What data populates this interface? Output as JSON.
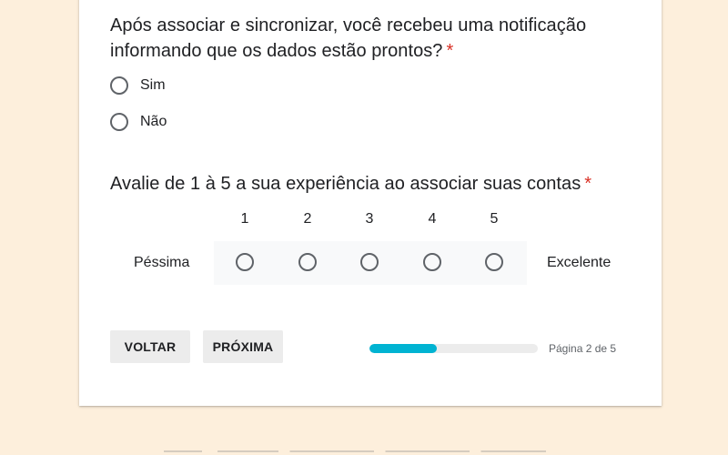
{
  "colors": {
    "page_background": "#fdefdc",
    "card_background": "#ffffff",
    "required_star": "#d93025",
    "progress_fill": "#00b3d2",
    "progress_track": "#ececec",
    "button_background": "#ececec"
  },
  "question1": {
    "title": "Após associar e sincronizar, você recebeu uma notificação informando que os dados estão prontos?",
    "required_mark": "*",
    "options": [
      {
        "label": "Sim",
        "selected": false,
        "icon": "radio-unchecked-icon"
      },
      {
        "label": "Não",
        "selected": false,
        "icon": "radio-unchecked-icon"
      }
    ]
  },
  "question2": {
    "title": "Avalie de 1 à 5 a sua experiência ao associar suas contas",
    "required_mark": "*",
    "scale": [
      "1",
      "2",
      "3",
      "4",
      "5"
    ],
    "low_label": "Péssima",
    "high_label": "Excelente",
    "selected": null
  },
  "navigation": {
    "back_label": "VOLTAR",
    "next_label": "PRÓXIMA"
  },
  "progress": {
    "current_page": 2,
    "total_pages": 5,
    "fraction": 0.4,
    "label": "Página 2 de 5"
  }
}
